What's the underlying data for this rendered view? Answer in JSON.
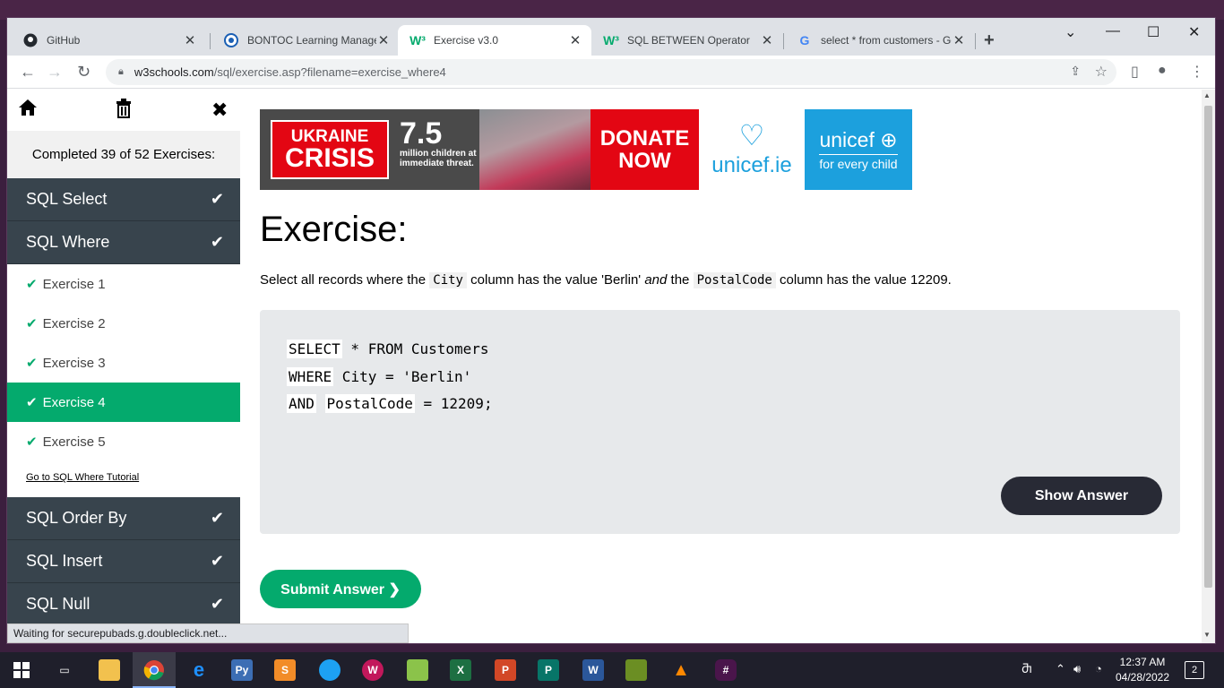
{
  "browser": {
    "tabs": [
      {
        "title": "GitHub",
        "icon": "github-icon",
        "active": false
      },
      {
        "title": "BONTOC Learning Managem",
        "icon": "lms-icon",
        "active": false
      },
      {
        "title": "Exercise v3.0",
        "icon": "w3schools-icon",
        "active": true
      },
      {
        "title": "SQL BETWEEN Operator",
        "icon": "w3schools-icon",
        "active": false
      },
      {
        "title": "select * from customers - Go",
        "icon": "google-icon",
        "active": false
      }
    ],
    "url_domain": "w3schools.com",
    "url_path": "/sql/exercise.asp?filename=exercise_where4",
    "status_text": "Waiting for securepubads.g.doubleclick.net..."
  },
  "sidebar": {
    "progress": "Completed 39 of 52 Exercises:",
    "categories_top": [
      {
        "label": "SQL Select"
      },
      {
        "label": "SQL Where"
      }
    ],
    "exercises": [
      {
        "label": "Exercise 1"
      },
      {
        "label": "Exercise 2"
      },
      {
        "label": "Exercise 3"
      },
      {
        "label": "Exercise 4"
      },
      {
        "label": "Exercise 5"
      }
    ],
    "tutorial_link": "Go to SQL Where Tutorial",
    "categories_bottom": [
      {
        "label": "SQL Order By"
      },
      {
        "label": "SQL Insert"
      },
      {
        "label": "SQL Null"
      }
    ]
  },
  "ad": {
    "badge_line1": "UKRAINE",
    "badge_line2": "CRISIS",
    "number": "7.5",
    "subtext": "million children at immediate threat.",
    "donate_line1": "DONATE",
    "donate_line2": "NOW",
    "unicef_ie": "unicef.ie",
    "unicef": "unicef",
    "tagline": "for every child"
  },
  "exercise": {
    "title": "Exercise:",
    "desc_1": "Select all records where the",
    "code_1": "City",
    "desc_2": "column has the value 'Berlin'",
    "desc_and": "and",
    "desc_3": "the",
    "code_2": "PostalCode",
    "desc_4": "column has the value 12209.",
    "code_line1_kw": "SELECT",
    "code_line1_rest": " * FROM Customers",
    "code_line2_kw": "WHERE",
    "code_line2_rest": " City = 'Berlin'",
    "code_line3_kw": "AND",
    "code_line3_field": "PostalCode",
    "code_line3_rest": " = 12209;",
    "show_answer": "Show Answer",
    "submit": "Submit Answer ❯"
  },
  "taskbar": {
    "time": "12:37 AM",
    "date": "04/28/2022",
    "notifications": "2"
  },
  "colors": {
    "w3_green": "#04aa6d",
    "sidebar_dark": "#38444d",
    "code_bg": "#e7e9eb",
    "dark_button": "#282a35"
  }
}
